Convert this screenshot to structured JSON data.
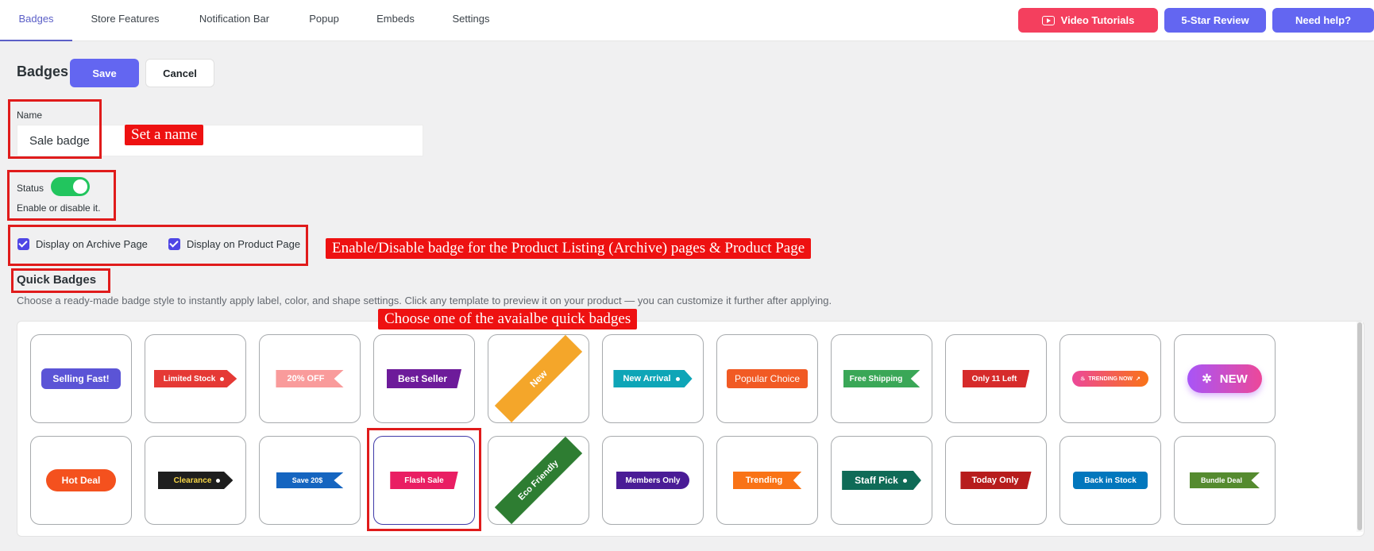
{
  "nav": {
    "tabs": [
      "Badges",
      "Store Features",
      "Notification Bar",
      "Popup",
      "Embeds",
      "Settings"
    ],
    "buttons": {
      "video": "Video Tutorials",
      "review": "5-Star Review",
      "help": "Need help?"
    }
  },
  "header": {
    "title": "Badges",
    "save_label": "Save",
    "cancel_label": "Cancel"
  },
  "form": {
    "name_label": "Name",
    "name_value": "Sale badge",
    "status_label": "Status",
    "status_help": "Enable or disable it.",
    "archive_label": "Display on Archive Page",
    "product_label": "Display on Product Page"
  },
  "quick_badges": {
    "title": "Quick Badges",
    "description": "Choose a ready-made badge style to instantly apply label, color, and shape settings. Click any template to preview it on your product — you can customize it further after applying.",
    "row1": [
      "Selling Fast!",
      "Limited Stock",
      "20% OFF",
      "Best Seller",
      "New",
      "New Arrival",
      "Popular Choice",
      "Free Shipping",
      "Only 11 Left",
      "TRENDING NOW",
      "NEW"
    ],
    "row2": [
      "Hot Deal",
      "Clearance",
      "Save 20$",
      "Flash Sale",
      "Eco Friendly",
      "Members Only",
      "Trending",
      "Staff Pick",
      "Today Only",
      "Back in Stock",
      "Bundle Deal"
    ]
  },
  "annotations": {
    "name": "Set a name",
    "display": "Enable/Disable badge for the Product Listing (Archive) pages & Product Page",
    "quick": "Choose one of the avaialbe quick badges"
  },
  "colors": {
    "accent": "#5b5fc7",
    "save": "#6366f1",
    "video": "#f43f5e",
    "annotation": "#ee1111",
    "toggle_on": "#22c55e"
  },
  "icons": [
    "video-play-icon",
    "check-icon",
    "sparkle-icon",
    "trend-arrow-icon",
    "fire-icon"
  ]
}
